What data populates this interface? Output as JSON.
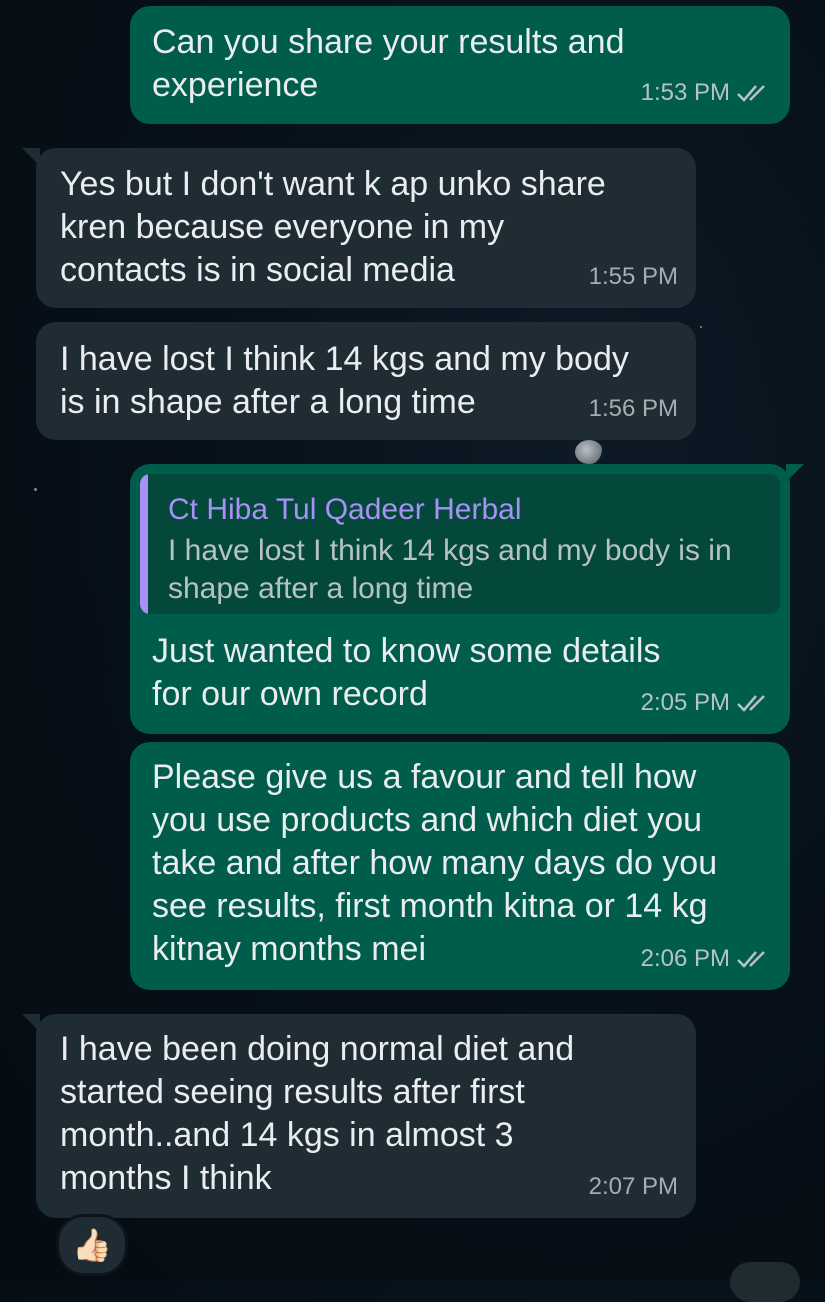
{
  "messages": [
    {
      "text": "Can you share your results and\nexperience",
      "time": "1:53 PM"
    },
    {
      "text": "Yes but I don't want k ap unko share\nkren because everyone in my\ncontacts is in social media",
      "time": "1:55 PM"
    },
    {
      "text": "I have lost I think 14 kgs and my body\nis in shape after a long time",
      "time": "1:56 PM"
    },
    {
      "quote_author": "Ct Hiba Tul Qadeer Herbal",
      "quote_text": "I have lost I think 14 kgs and my body is in\nshape after a long time",
      "text": "Just wanted to know some details\nfor our own record",
      "time": "2:05 PM"
    },
    {
      "text": "Please give us a favour and tell how\nyou use products and which diet you\ntake and after how many days do you\nsee results, first month kitna or 14 kg\nkitnay months mei",
      "time": "2:06 PM"
    },
    {
      "text": "I have been doing normal diet and\nstarted seeing results after first\nmonth..and 14 kgs in almost 3\nmonths I think",
      "time": "2:07 PM"
    }
  ],
  "reaction": {
    "emoji": "👍🏻"
  },
  "colors": {
    "outgoing": "#005c4b",
    "incoming": "#202c33",
    "quote_accent": "#a791f5"
  },
  "icons": {
    "read_receipt": "double-check-icon"
  }
}
